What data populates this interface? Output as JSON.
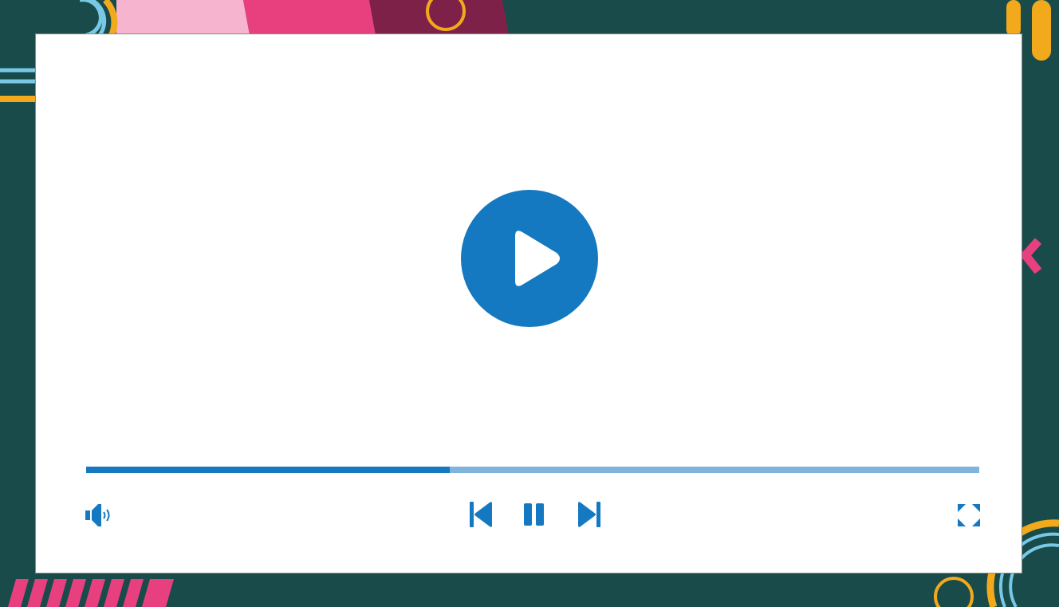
{
  "colors": {
    "background": "#184b4a",
    "player_bg": "#ffffff",
    "accent": "#1479c0",
    "track": "#7fb4dc",
    "deco_pink_light": "#f6b4cf",
    "deco_pink": "#e8407f",
    "deco_maroon": "#7e2148",
    "deco_yellow": "#f2a91c",
    "deco_cyan": "#79c8e6"
  },
  "player": {
    "progress_fraction": 0.407,
    "center_button_icon": "play-icon",
    "controls": {
      "volume_icon": "volume-icon",
      "prev_icon": "skip-previous-icon",
      "pause_icon": "pause-icon",
      "next_icon": "skip-next-icon",
      "fullscreen_icon": "fullscreen-icon"
    }
  }
}
